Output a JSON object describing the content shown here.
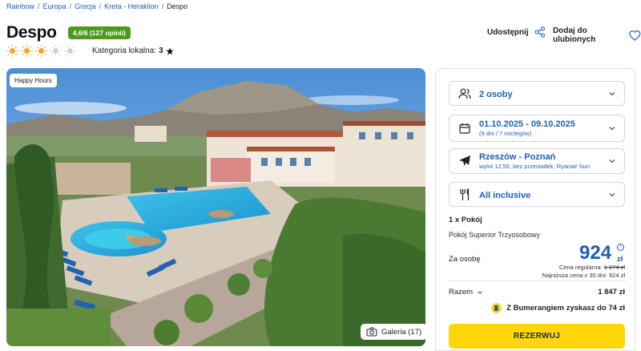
{
  "breadcrumb": [
    "Rainbow",
    "Europa",
    "Grecja",
    "Kreta - Heraklion",
    "Despo"
  ],
  "hotel": {
    "name": "Despo",
    "rating_badge": "4,6/6 (127 opinii)",
    "suns_total": 5,
    "suns_filled": 3,
    "local_category_label": "Kategoria lokalna:",
    "local_category_value": "3"
  },
  "actions": {
    "share_label": "Udostępnij",
    "favorite_label": "Dodaj do ulubionych"
  },
  "gallery": {
    "badge": "Happy Hours",
    "button_label": "Galeria (17)"
  },
  "booking": {
    "persons": "2 osoby",
    "dates": "01.10.2025 - 09.10.2025",
    "dates_sub": "(9 dni / 7 noclegów)",
    "flight": "Rzeszów - Poznań",
    "flight_sub": "wylot 12:55, bez przesiadek, Ryanair Sun",
    "board": "All inclusive",
    "rooms": "1 x Pokój",
    "room_type": "Pokój Superior Trzyosobowy",
    "per_person_label": "Za osobę",
    "price": "924",
    "currency": "zł",
    "info_icon": "i",
    "regular_label": "Cena regularna:",
    "regular_price": "1 274 zł",
    "lowest_30": "Najniższa cena z 30 dni: 924 zł",
    "total_label": "Razem",
    "total_value": "1 847 zł",
    "bumerang_text": "Z Bumerangiem zyskasz do 74 zł",
    "reserve_label": "REZERWUJ"
  },
  "colors": {
    "accent_blue": "#1f5fb8",
    "rating_green": "#4c9a1e",
    "reserve_yellow": "#ffd60a",
    "sun_on": "#f5a623",
    "sun_off": "#d0d0d0"
  }
}
